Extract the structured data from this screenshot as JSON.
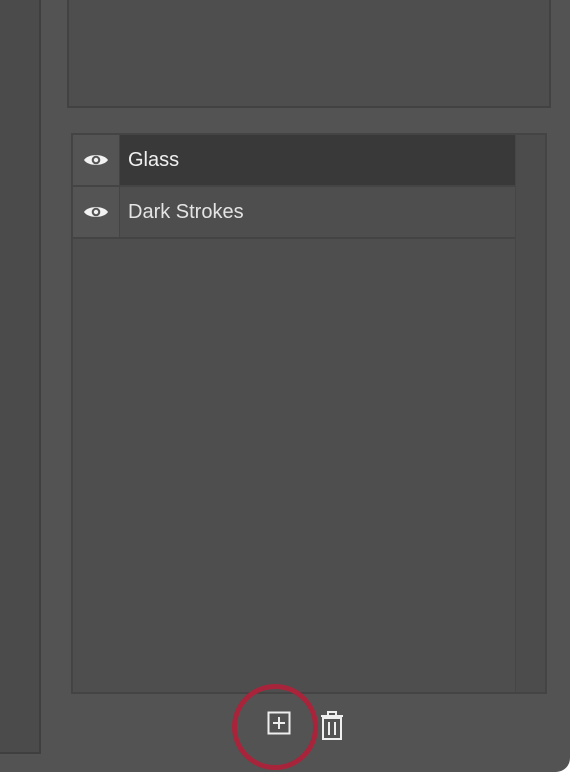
{
  "layers": [
    {
      "name": "Glass",
      "visible": true,
      "selected": true
    },
    {
      "name": "Dark Strokes",
      "visible": true,
      "selected": false
    }
  ],
  "icons": {
    "visibility": "eye-icon",
    "add": "plus-square-icon",
    "delete": "trash-icon"
  },
  "colors": {
    "panel": "#535353",
    "selected_row": "#393939",
    "text": "#f0f0f0",
    "highlight_ring": "#a8243a"
  }
}
